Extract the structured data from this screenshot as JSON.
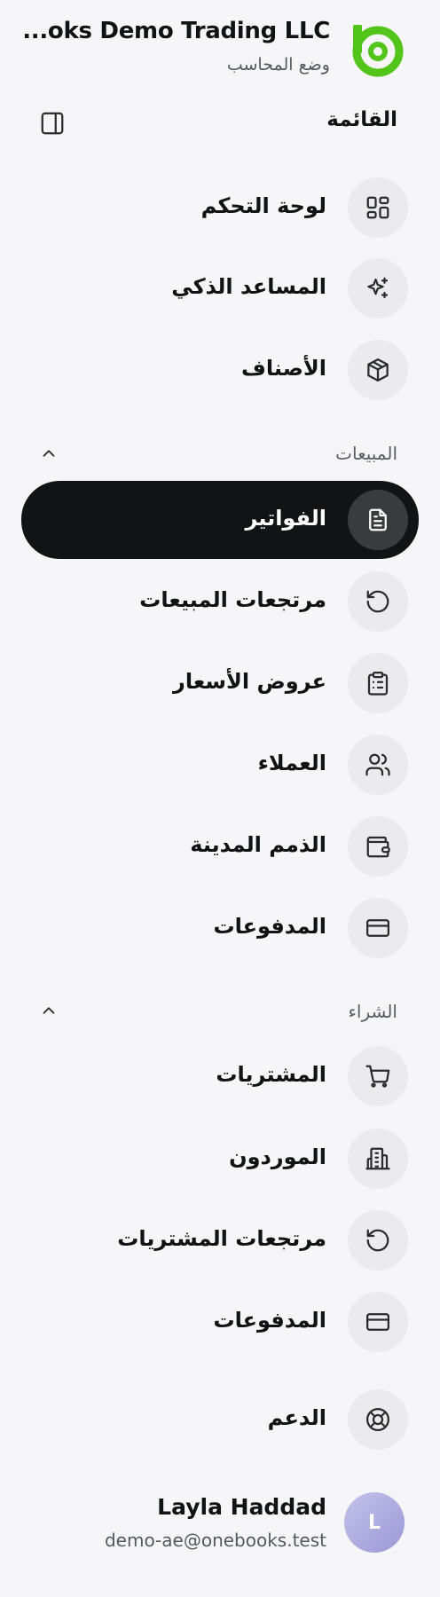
{
  "header": {
    "company_name": "...oks Demo Trading LLC",
    "mode": "وضع المحاسب",
    "logo_icon": "onebooks-logo-icon",
    "brand_color": "#52c41a"
  },
  "menu": {
    "title": "القائمة",
    "collapse_icon": "sidebar-panel-icon"
  },
  "main_items": [
    {
      "label": "لوحة التحكم",
      "icon": "dashboard-grid-icon"
    },
    {
      "label": "المساعد الذكي",
      "icon": "sparkles-icon"
    },
    {
      "label": "الأصناف",
      "icon": "box-icon"
    }
  ],
  "sales": {
    "title": "المبيعات",
    "items": [
      {
        "label": "الفواتير",
        "icon": "file-text-icon",
        "active": true
      },
      {
        "label": "مرتجعات المبيعات",
        "icon": "rotate-ccw-icon"
      },
      {
        "label": "عروض الأسعار",
        "icon": "clipboard-list-icon"
      },
      {
        "label": "العملاء",
        "icon": "users-icon"
      },
      {
        "label": "الذمم المدينة",
        "icon": "wallet-icon"
      },
      {
        "label": "المدفوعات",
        "icon": "credit-card-icon"
      }
    ]
  },
  "purchases": {
    "title": "الشراء",
    "items": [
      {
        "label": "المشتريات",
        "icon": "shopping-cart-icon"
      },
      {
        "label": "الموردون",
        "icon": "building-icon"
      },
      {
        "label": "مرتجعات المشتريات",
        "icon": "rotate-ccw-icon"
      },
      {
        "label": "المدفوعات",
        "icon": "credit-card-icon"
      }
    ]
  },
  "support": {
    "label": "الدعم",
    "icon": "life-buoy-icon"
  },
  "user": {
    "initial": "L",
    "name": "Layla Haddad",
    "email": "demo-ae@onebooks.test"
  }
}
